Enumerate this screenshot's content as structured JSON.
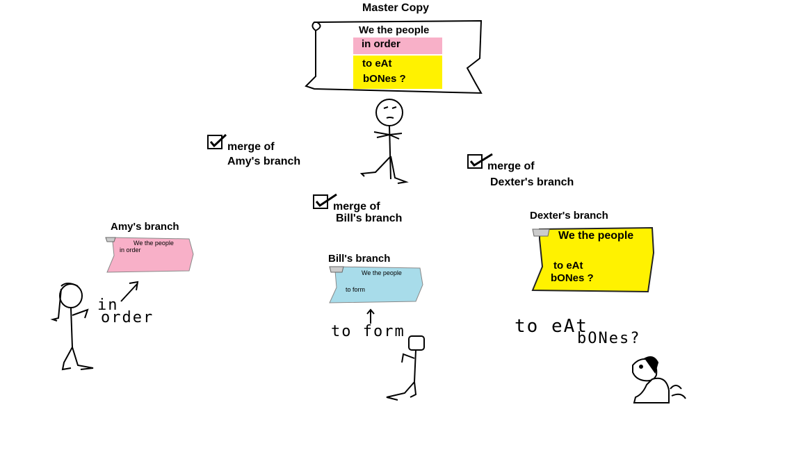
{
  "master": {
    "title": "Master Copy",
    "lines": [
      "We the people",
      "in order",
      "to eAt",
      "bONes ?"
    ],
    "colors": {
      "pink": "#f8b0c8",
      "yellow": "#fff200"
    }
  },
  "merges": [
    {
      "line1": "merge of",
      "line2": "Amy's branch"
    },
    {
      "line1": "merge of",
      "line2": "Bill's branch"
    },
    {
      "line1": "merge of",
      "line2": "Dexter's branch"
    }
  ],
  "branches": {
    "amy": {
      "title": "Amy's branch",
      "lines": [
        "We the people",
        "in order"
      ],
      "color": "#f8b0c8",
      "handwriting": [
        "in",
        "order"
      ]
    },
    "bill": {
      "title": "Bill's branch",
      "lines": [
        "We the people",
        "to form"
      ],
      "color": "#a8dcea",
      "handwriting": [
        "to form"
      ]
    },
    "dexter": {
      "title": "Dexter's branch",
      "lines": [
        "We the people",
        "to eAt",
        "bONes ?"
      ],
      "color": "#fff200",
      "handwriting": [
        "to eAt",
        "bONes?"
      ]
    }
  },
  "icons": [
    "checkmark-icon",
    "stick-figure-icon",
    "dog-icon",
    "arrow-icon",
    "scroll-icon"
  ]
}
